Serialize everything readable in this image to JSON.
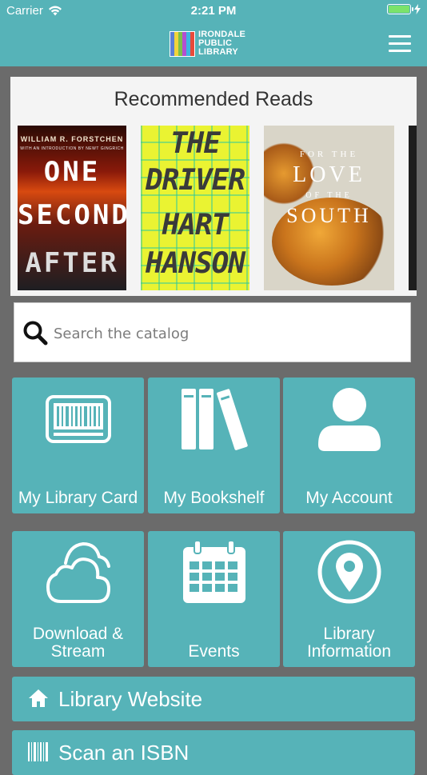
{
  "status_bar": {
    "carrier": "Carrier",
    "time": "2:21 PM",
    "battery_level": 1.0
  },
  "header": {
    "logo_lines": [
      "IRONDALE",
      "PUBLIC",
      "LIBRARY"
    ],
    "logo_colors": [
      "#5b7fd6",
      "#f1d43a",
      "#7cc04a",
      "#b34fd0",
      "#3cb5e0",
      "#e84a3a"
    ],
    "menu_icon": "hamburger-menu-icon"
  },
  "recommended": {
    "title": "Recommended Reads",
    "books": [
      {
        "author": "WILLIAM R. FORSTCHEN",
        "intro": "WITH AN INTRODUCTION BY NEWT GINGRICH",
        "title_lines": [
          "ONE",
          "SECOND",
          "AFTER"
        ]
      },
      {
        "title_lines": [
          "THE",
          "DRIVER",
          "HART",
          "HANSON"
        ]
      },
      {
        "title_lines": [
          "FOR THE",
          "LOVE",
          "OF THE",
          "SOUTH"
        ]
      }
    ]
  },
  "search": {
    "placeholder": "Search the catalog",
    "value": ""
  },
  "tiles": [
    {
      "label": "My Library Card",
      "icon": "library-card-barcode-icon"
    },
    {
      "label": "My Bookshelf",
      "icon": "bookshelf-icon"
    },
    {
      "label": "My Account",
      "icon": "user-account-icon"
    },
    {
      "label_line1": "Download &",
      "label_line2": "Stream",
      "icon": "cloud-icon"
    },
    {
      "label": "Events",
      "icon": "calendar-icon"
    },
    {
      "label_line1": "Library",
      "label_line2": "Information",
      "icon": "location-pin-icon"
    }
  ],
  "links": [
    {
      "label": "Library Website",
      "icon": "home-icon"
    },
    {
      "label": "Scan an ISBN",
      "icon": "barcode-icon"
    }
  ]
}
